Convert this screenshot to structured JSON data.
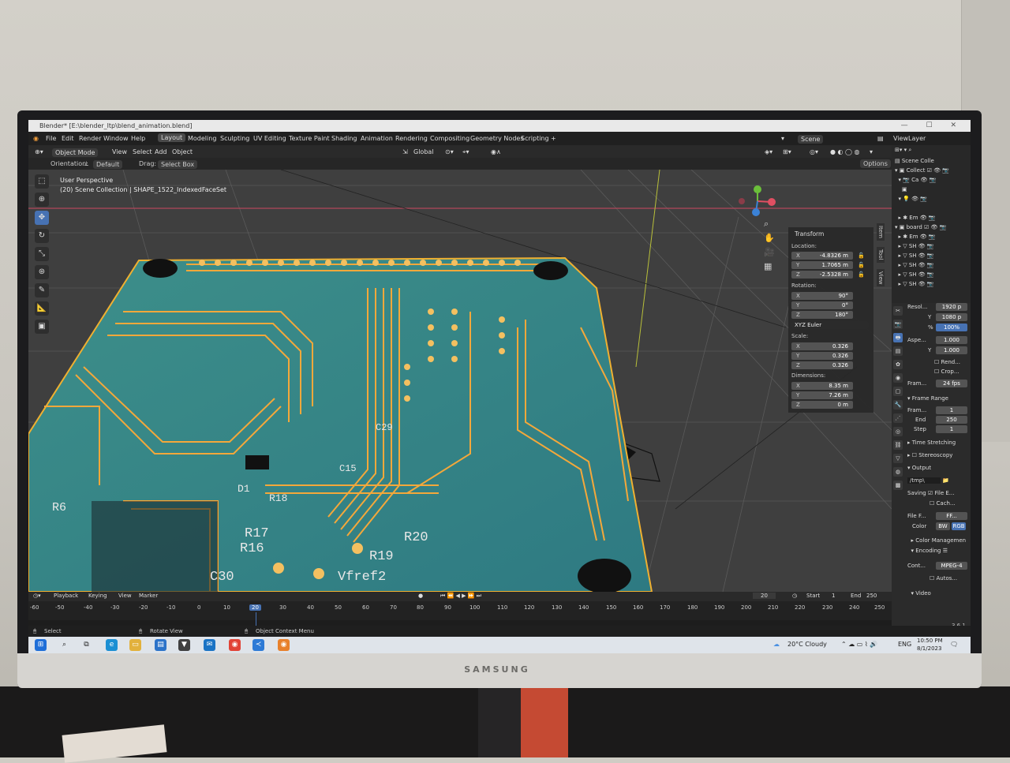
{
  "window": {
    "title": "Blender* [E:\\blender_ltp\\blend_animation.blend]",
    "controls": [
      "—",
      "☐",
      "✕"
    ]
  },
  "menu": [
    "File",
    "Edit",
    "Render",
    "Window",
    "Help"
  ],
  "workspaces": [
    "Layout",
    "Modeling",
    "Sculpting",
    "UV Editing",
    "Texture Paint",
    "Shading",
    "Animation",
    "Rendering",
    "Compositing",
    "Geometry Nodes",
    "Scripting",
    "+"
  ],
  "scene": {
    "name": "Scene",
    "view_layer": "ViewLayer"
  },
  "header": {
    "mode": "Object Mode",
    "view": "View",
    "select": "Select",
    "add": "Add",
    "object": "Object",
    "transform_space": "Global",
    "options": "Options"
  },
  "subheader": {
    "orientation_label": "Orientation:",
    "orientation_value": "Default",
    "drag_label": "Drag:",
    "drag_value": "Select Box"
  },
  "viewport": {
    "perspective": "User Perspective",
    "collection_info": "(20) Scene Collection | SHAPE_1522_IndexedFaceSet",
    "pcb_labels": [
      "R6",
      "D1",
      "R18",
      "R17",
      "R16",
      "C30",
      "R19",
      "R20",
      "Vfref2",
      "C29",
      "C15"
    ]
  },
  "transform_panel": {
    "title": "Transform",
    "location_label": "Location:",
    "location": {
      "x": "-4.8326 m",
      "y": "1.7065 m",
      "z": "-2.5328 m"
    },
    "rotation_label": "Rotation:",
    "rotation": {
      "x": "90°",
      "y": "0°",
      "z": "180°"
    },
    "rotation_mode": "XYZ Euler",
    "scale_label": "Scale:",
    "scale": {
      "x": "0.326",
      "y": "0.326",
      "z": "0.326"
    },
    "dimensions_label": "Dimensions:",
    "dimensions": {
      "x": "8.35 m",
      "y": "7.26 m",
      "z": "0 m"
    },
    "side_tabs": [
      "Item",
      "Tool",
      "View"
    ]
  },
  "outliner": {
    "rows": [
      "Scene Colle",
      "Collect",
      "Ca",
      "",
      "Em",
      "board",
      "Em",
      "SH",
      "SH",
      "SH",
      "SH",
      "SH"
    ]
  },
  "properties": {
    "resolution_y": "1080 p",
    "resolution_x_partial": "1920 p",
    "resolution_pct": "100%",
    "aspect_label": "Aspe...",
    "aspect_x": "1.000",
    "aspect_y": "1.000",
    "render_region": "Rend...",
    "crop": "Crop...",
    "frame_rate_label": "Fram...",
    "frame_rate": "24 fps",
    "frame_range_title": "Frame Range",
    "frame_start_label": "Fram...",
    "frame_start": "1",
    "frame_end_label": "End",
    "frame_end": "250",
    "step_label": "Step",
    "step": "1",
    "time_stretching": "Time Stretching",
    "stereoscopy": "Stereoscopy",
    "output_title": "Output",
    "output_path": "/tmp\\",
    "saving_label": "Saving",
    "file_ext": "File E...",
    "cache": "Cach...",
    "file_format_label": "File F...",
    "file_format": "FF...",
    "color_label": "Color",
    "color_bw": "BW",
    "color_rgb": "RGB",
    "color_management": "Color Managemen",
    "encoding": "Encoding",
    "container_label": "Cont...",
    "container": "MPEG-4",
    "autosplit": "Autos...",
    "video": "Video",
    "labels_y": "Y",
    "labels_pct": "%",
    "reso_label": "Resol..."
  },
  "timeline": {
    "menus": [
      "Playback",
      "Keying",
      "View",
      "Marker"
    ],
    "current_frame": "20",
    "start_label": "Start",
    "start": "1",
    "end_label": "End",
    "end": "250",
    "ticks": [
      "-60",
      "-50",
      "-40",
      "-30",
      "-20",
      "-10",
      "0",
      "10",
      "20",
      "30",
      "40",
      "50",
      "60",
      "70",
      "80",
      "90",
      "100",
      "110",
      "120",
      "130",
      "140",
      "150",
      "160",
      "170",
      "180",
      "190",
      "200",
      "210",
      "220",
      "230",
      "240",
      "250"
    ]
  },
  "statusbar": {
    "select": "Select",
    "rotate": "Rotate View",
    "context": "Object Context Menu",
    "version": "3.6.1"
  },
  "taskbar": {
    "weather": "20°C Cloudy",
    "lang": "ENG",
    "time": "10:50 PM",
    "date": "8/1/2023",
    "notifications": "2"
  },
  "monitor": {
    "brand": "SAMSUNG"
  }
}
